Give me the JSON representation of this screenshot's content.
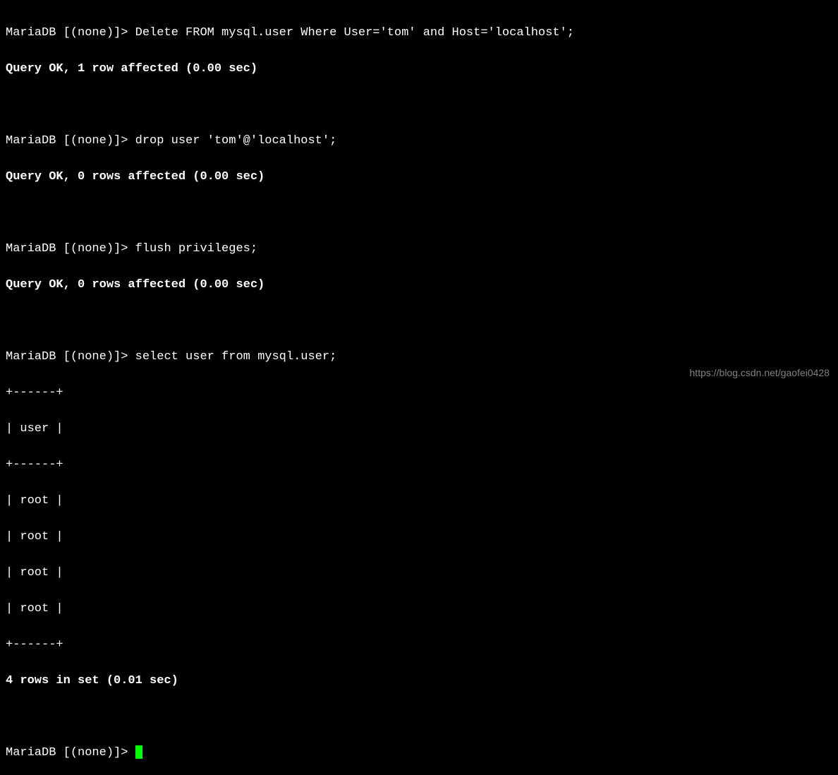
{
  "prompt": "MariaDB [(none)]> ",
  "commands": {
    "cmd1": "Delete FROM mysql.user Where User='tom' and Host='localhost';",
    "result1": "Query OK, 1 row affected (0.00 sec)",
    "cmd2": "drop user 'tom'@'localhost';",
    "result2": "Query OK, 0 rows affected (0.00 sec)",
    "cmd3": "flush privileges;",
    "result3": "Query OK, 0 rows affected (0.00 sec)",
    "cmd4": "select user from mysql.user;"
  },
  "table": {
    "border_top": "+------+",
    "header": "| user |",
    "border_mid": "+------+",
    "rows": [
      "| root |",
      "| root |",
      "| root |",
      "| root |"
    ],
    "border_bottom": "+------+",
    "summary": "4 rows in set (0.01 sec)"
  },
  "watermark": "https://blog.csdn.net/gaofei0428"
}
